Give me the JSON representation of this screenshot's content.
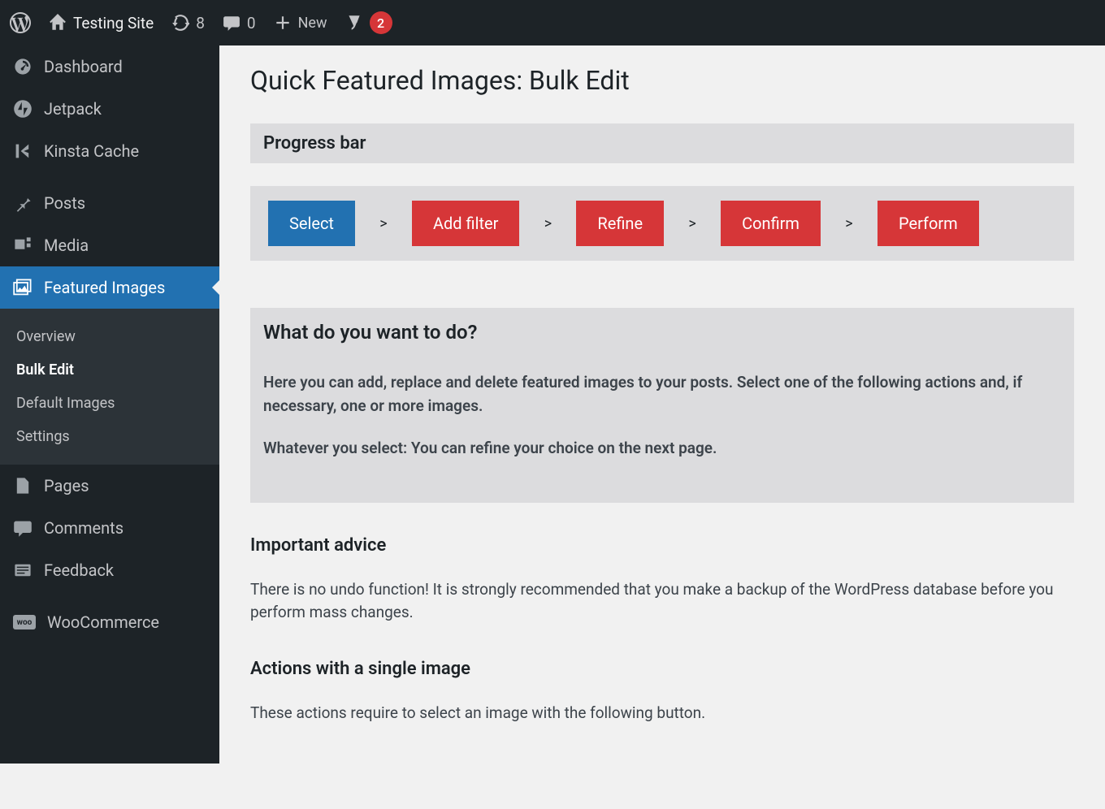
{
  "adminbar": {
    "site_name": "Testing Site",
    "updates_count": "8",
    "comments_count": "0",
    "new_label": "New",
    "yoast_badge": "2"
  },
  "sidebar": {
    "items": [
      {
        "label": "Dashboard",
        "icon": "dashboard"
      },
      {
        "label": "Jetpack",
        "icon": "jetpack"
      },
      {
        "label": "Kinsta Cache",
        "icon": "kinsta"
      },
      {
        "label": "Posts",
        "icon": "pin"
      },
      {
        "label": "Media",
        "icon": "media"
      },
      {
        "label": "Featured Images",
        "icon": "images"
      },
      {
        "label": "Pages",
        "icon": "pages"
      },
      {
        "label": "Comments",
        "icon": "comment"
      },
      {
        "label": "Feedback",
        "icon": "feedback"
      },
      {
        "label": "WooCommerce",
        "icon": "woo"
      }
    ],
    "submenu": [
      {
        "label": "Overview"
      },
      {
        "label": "Bulk Edit"
      },
      {
        "label": "Default Images"
      },
      {
        "label": "Settings"
      }
    ]
  },
  "page": {
    "title": "Quick Featured Images: Bulk Edit",
    "progress_heading": "Progress bar",
    "steps": [
      "Select",
      "Add filter",
      "Refine",
      "Confirm",
      "Perform"
    ],
    "step_sep": ">",
    "info_heading": "What do you want to do?",
    "info_p1": "Here you can add, replace and delete featured images to your posts. Select one of the following actions and, if necessary, one or more images.",
    "info_p2": "Whatever you select: You can refine your choice on the next page.",
    "advice_heading": "Important advice",
    "advice_p": "There is no undo function! It is strongly recommended that you make a backup of the WordPress database before you perform mass changes.",
    "actions_heading": "Actions with a single image",
    "actions_p": "These actions require to select an image with the following button."
  },
  "colors": {
    "accent_blue": "#2271b1",
    "step_orange": "#d63638",
    "panel_gray": "#dcdcde"
  }
}
